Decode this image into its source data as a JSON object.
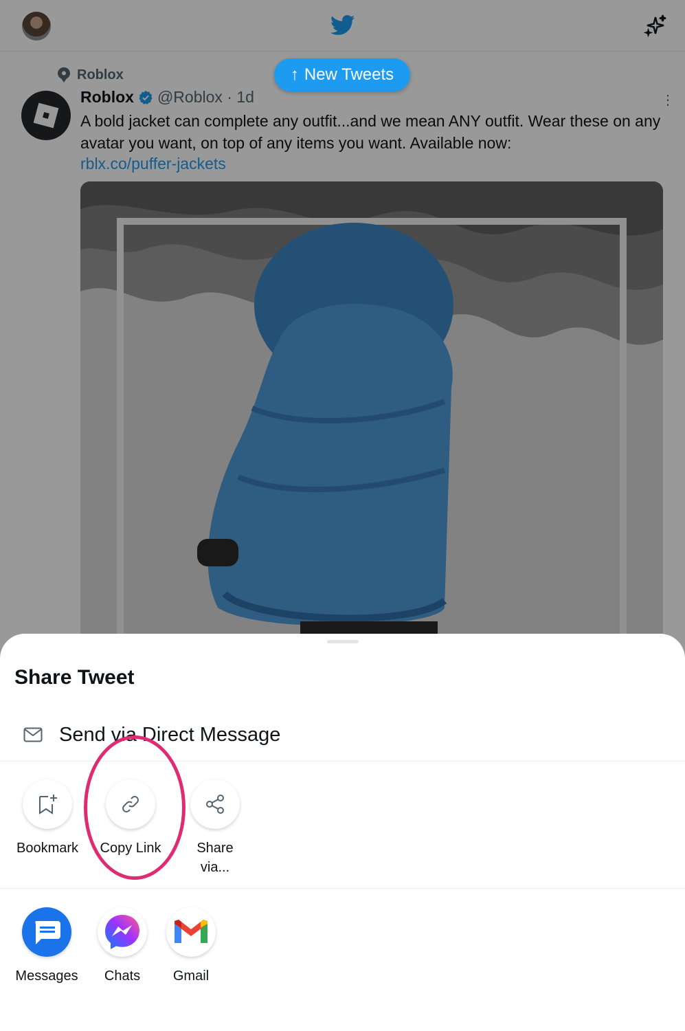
{
  "topbar": {
    "avatar": "profile-photo",
    "logo": "twitter-bird-icon",
    "sparkle": "sparkle-icon"
  },
  "new_tweets_label": "New Tweets",
  "tweet": {
    "pinned_label": "Roblox",
    "author_name": "Roblox",
    "author_handle": "@Roblox · 1d",
    "text": "A bold jacket can complete any outfit...and we mean ANY outfit. Wear these on any avatar you want, on top of any items you want. Available now:",
    "link": "rblx.co/puffer-jackets"
  },
  "share_sheet": {
    "title": "Share Tweet",
    "dm_label": "Send via Direct Message",
    "actions": [
      {
        "label": "Bookmark",
        "icon": "bookmark-add-icon"
      },
      {
        "label": "Copy Link",
        "icon": "link-icon"
      },
      {
        "label": "Share via...",
        "icon": "share-icon"
      }
    ],
    "apps": [
      {
        "label": "Messages",
        "icon": "messages-app-icon"
      },
      {
        "label": "Chats",
        "icon": "messenger-app-icon"
      },
      {
        "label": "Gmail",
        "icon": "gmail-app-icon"
      }
    ]
  },
  "colors": {
    "accent": "#1d9bf0",
    "highlight": "#de2b73",
    "overlay": "rgba(0,0,0,0.4)"
  }
}
